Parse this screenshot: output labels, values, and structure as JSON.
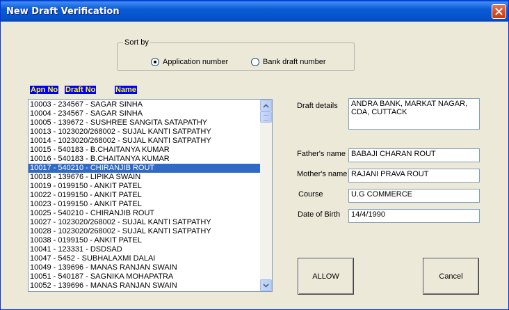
{
  "window": {
    "title": "New Draft Verification"
  },
  "sort_by": {
    "legend": "Sort by",
    "options": [
      {
        "label": "Application number",
        "selected": true
      },
      {
        "label": "Bank draft number",
        "selected": false
      }
    ]
  },
  "list_headers": {
    "apn_no": "Apn No",
    "draft_no": "Draft No",
    "name": "Name"
  },
  "list": {
    "selected_index": 7,
    "items": [
      "10003  -  234567  -  SAGAR SINHA",
      "10004  -  234567  -  SAGAR SINHA",
      "10005  -  139672  -  SUSHREE SANGITA SATAPATHY",
      "10013  -  1023020/268002  -  SUJAL KANTI SATPATHY",
      "10014  -  1023020/268002  -  SUJAL KANTI SATPATHY",
      "10015  -  540183  - B.CHAITANYA KUMAR",
      "10016  -  540183  - B.CHAITANYA KUMAR",
      "10017  -  540210  -  CHIRANJIB ROUT",
      "10018  -  139676  -  LIPIKA SWAIN",
      "10019  -  0199150  -  ANKIT PATEL",
      "10022  -  0199150  -  ANKIT PATEL",
      "10023  -  0199150  -  ANKIT PATEL",
      "10025  -  540210  -  CHIRANJIB ROUT",
      "10027  -  1023020/268002  -  SUJAL KANTI SATPATHY",
      "10028  -  1023020/268002  -  SUJAL KANTI SATPATHY",
      "10038  -  0199150  -  ANKIT PATEL",
      "10041  -  123331  -  DSDSAD",
      "10047  -  5452  -  SUBHALAXMI  DALAI",
      "10049  -  139696  -  MANAS RANJAN SWAIN",
      "10051  -  540187  -  SAGNIKA MOHAPATRA",
      "10052  -  139696  -  MANAS RANJAN SWAIN"
    ]
  },
  "details": {
    "draft_details_label": "Draft details",
    "draft_details_value": "ANDRA BANK, MARKAT NAGAR, CDA, CUTTACK",
    "fathers_name_label": "Father's name",
    "fathers_name_value": "BABAJI CHARAN ROUT",
    "mothers_name_label": "Mother's name",
    "mothers_name_value": "RAJANI PRAVA ROUT",
    "course_label": "Course",
    "course_value": "U.G  COMMERCE",
    "dob_label": "Date of Birth",
    "dob_value": "14/4/1990"
  },
  "buttons": {
    "allow": "ALLOW",
    "cancel": "Cancel"
  },
  "colors": {
    "titlebar": "#0a5bd6",
    "selection": "#316ac5",
    "header_bg": "#0000ff",
    "header_text": "#ffff00",
    "dialog_bg": "#ece9d8"
  },
  "icons": {
    "close": "close-icon",
    "scroll_up": "arrow-up-icon",
    "scroll_down": "arrow-down-icon"
  }
}
